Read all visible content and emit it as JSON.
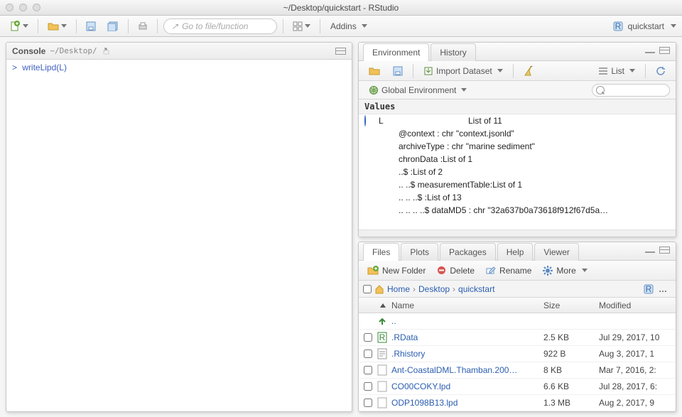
{
  "window": {
    "title": "~/Desktop/quickstart - RStudio"
  },
  "toolbar": {
    "gofile_placeholder": "Go to file/function",
    "addins_label": "Addins",
    "project_label": "quickstart"
  },
  "console": {
    "title": "Console",
    "path": "~/Desktop/",
    "prompt": ">",
    "code": "writeLipd(L)"
  },
  "env_panel": {
    "tabs": [
      "Environment",
      "History"
    ],
    "active_tab": 0,
    "import_label": "Import Dataset",
    "list_label": "List",
    "scope_label": "Global Environment",
    "section": "Values",
    "rows": [
      {
        "icon": true,
        "name": "L",
        "value": "List of 11",
        "indent": 0
      },
      {
        "icon": false,
        "name": "",
        "value": "@context : chr \"context.jsonld\"",
        "indent": 1
      },
      {
        "icon": false,
        "name": "",
        "value": "archiveType : chr \"marine sediment\"",
        "indent": 1
      },
      {
        "icon": false,
        "name": "",
        "value": "chronData :List of 1",
        "indent": 1
      },
      {
        "icon": false,
        "name": "",
        "value": "..$ :List of 2",
        "indent": 1
      },
      {
        "icon": false,
        "name": "",
        "value": ".. ..$ measurementTable:List of 1",
        "indent": 1
      },
      {
        "icon": false,
        "name": "",
        "value": ".. .. ..$ :List of 13",
        "indent": 1
      },
      {
        "icon": false,
        "name": "",
        "value": ".. .. .. ..$ dataMD5 : chr \"32a637b0a73618f912f67d5a…",
        "indent": 1
      }
    ]
  },
  "files_panel": {
    "tabs": [
      "Files",
      "Plots",
      "Packages",
      "Help",
      "Viewer"
    ],
    "active_tab": 0,
    "btn_new_folder": "New Folder",
    "btn_delete": "Delete",
    "btn_rename": "Rename",
    "btn_more": "More",
    "breadcrumb": [
      "Home",
      "Desktop",
      "quickstart"
    ],
    "columns": {
      "name": "Name",
      "size": "Size",
      "modified": "Modified"
    },
    "rows": [
      {
        "type": "up",
        "name": "..",
        "size": "",
        "modified": ""
      },
      {
        "type": "rdata",
        "name": ".RData",
        "size": "2.5 KB",
        "modified": "Jul 29, 2017, 10"
      },
      {
        "type": "text",
        "name": ".Rhistory",
        "size": "922 B",
        "modified": "Aug 3, 2017, 1"
      },
      {
        "type": "file",
        "name": "Ant-CoastalDML.Thamban.200…",
        "size": "8 KB",
        "modified": "Mar 7, 2016, 2:"
      },
      {
        "type": "file",
        "name": "CO00COKY.lpd",
        "size": "6.6 KB",
        "modified": "Jul 28, 2017, 6:"
      },
      {
        "type": "file",
        "name": "ODP1098B13.lpd",
        "size": "1.3 MB",
        "modified": "Aug 2, 2017, 9"
      }
    ]
  }
}
